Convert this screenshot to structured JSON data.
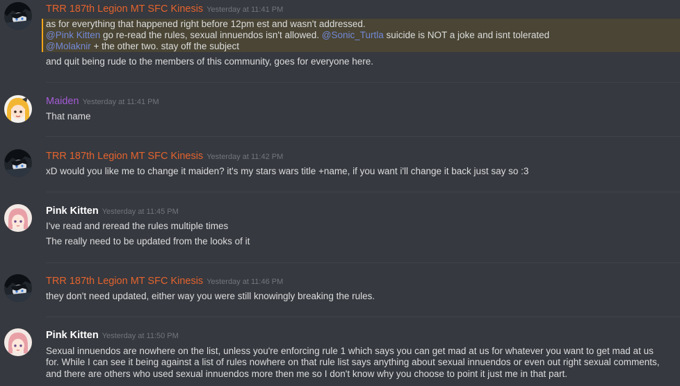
{
  "colors": {
    "background": "#36393f",
    "kinesis_name": "#e4632e",
    "maiden_name": "#a45bd6",
    "pink_name": "#ffffff",
    "mention": "#7289da",
    "mention_highlight": "#4a4534",
    "timestamp": "#72767d",
    "text": "#dcddde"
  },
  "messages": [
    {
      "author": "TRR 187th Legion MT SFC Kinesis",
      "timestamp": "Yesterday at 11:41 PM",
      "highlight_lines": [
        "as for everything that happened right before 12pm est and wasn't addressed.",
        {
          "m1": "@Pink Kitten",
          "t1": " go re-read the rules, sexual innuendos isn't allowed.  ",
          "m2": "@Sonic_Turtla",
          "t2": " suicide is NOT a joke and isnt tolerated"
        },
        {
          "m1": "@Molaknir",
          "t1": " + the other two. stay off the subject"
        }
      ],
      "lines": [
        "and quit being rude to the members of this community, goes for everyone here."
      ]
    },
    {
      "author": "Maiden",
      "timestamp": "Yesterday at 11:41 PM",
      "lines": [
        "That name"
      ]
    },
    {
      "author": "TRR 187th Legion MT SFC Kinesis",
      "timestamp": "Yesterday at 11:42 PM",
      "lines": [
        "xD would you like me to change it maiden? it's my stars wars title +name, if you want i'll change it back just say so :3"
      ]
    },
    {
      "author": "Pink Kitten",
      "timestamp": "Yesterday at 11:45 PM",
      "lines": [
        "I've read and reread the rules multiple times",
        "The really need to be updated from the looks of it"
      ]
    },
    {
      "author": "TRR 187th Legion MT SFC Kinesis",
      "timestamp": "Yesterday at 11:46 PM",
      "lines": [
        "they don't need updated, either way you were still knowingly breaking the rules."
      ]
    },
    {
      "author": "Pink Kitten",
      "timestamp": "Yesterday at 11:50 PM",
      "lines": [
        "Sexual innuendos are nowhere on the list, unless you're enforcing rule 1 which says you can get mad at us for whatever you want to get mad at us",
        "for. While I can see it being against a list of rules nowhere on that rule list says anything about sexual innuendos or even out right sexual comments,",
        "and there are others who used sexual innuendos more then me so I don't know why you choose to point it just me in that part."
      ]
    }
  ]
}
